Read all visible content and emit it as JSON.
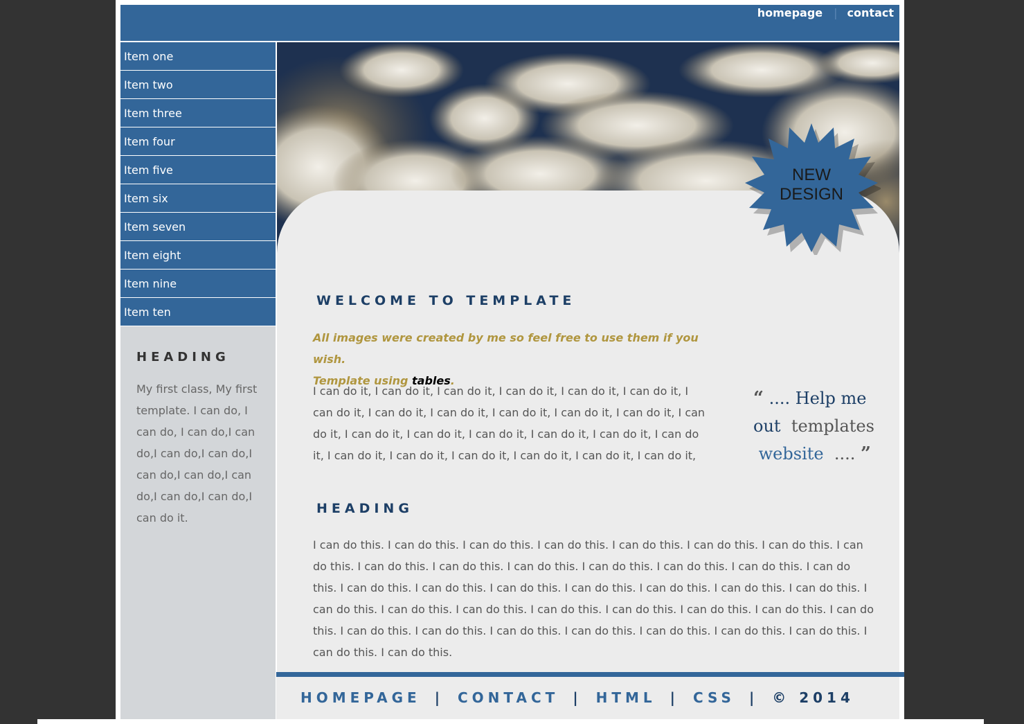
{
  "header": {
    "links": [
      "homepage",
      "contact"
    ]
  },
  "sidebar": {
    "menu": [
      "Item one",
      "Item two",
      "Item three",
      "Item four",
      "Item five",
      "Item six",
      "Item seven",
      "Item eight",
      "Item nine",
      "Item ten"
    ],
    "heading": "HEADING",
    "text": "My first class, My first template. I can do, I can do, I can do,I can do,I can do,I can do,I can do,I can do,I can do,I can do,I can do,I can do it."
  },
  "badge": {
    "line1": "NEW",
    "line2": "DESIGN"
  },
  "main": {
    "welcome": "WELCOME TO TEMPLATE",
    "intro_line1": "All images were created by me so feel free to use them if you wish.",
    "intro_line2_prefix": "Template using ",
    "intro_line2_em": "tables",
    "intro_line2_suffix": ".",
    "body": "I can do it, I can do it, I can do it, I can do it, I can do it, I can do it, I can do it, I can do it, I can do it, I can do it, I can do it, I can do it, I can do it, I can do it, I can do it, I can do it, I can do it, I can do it, I can do it, I can do it, I can do it, I can do it, I can do it, I can do it, I can do it,",
    "quote": {
      "open": "“",
      "part1": " .... Help me",
      "part2": "out",
      "part3": "templates",
      "part4": "website",
      "part5": " ....",
      "close": "”"
    },
    "heading2": "HEADING",
    "body2": "I can do this. I can do this. I can do this. I can do this. I can do this. I can do this. I can do this. I can do this. I can do this. I can do this. I can do this. I can do this. I can do this. I can do this. I can do this. I can do this. I can do this. I can do this. I can do this. I can do this. I can do this. I can do this. I can do this. I can do this. I can do this. I can do this. I can do this. I can do this. I can do this. I can do this. I can do this. I can do this. I can do this. I can do this. I can do this. I can do this. I can do this. I can do this. I can do this."
  },
  "footer": {
    "links": [
      "HOMEPAGE",
      "CONTACT",
      "HTML",
      "CSS"
    ],
    "separator": "|",
    "copyright": "© 2014"
  }
}
